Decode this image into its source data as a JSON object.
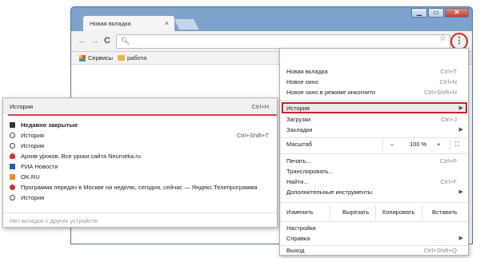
{
  "browser": {
    "tab_title": "Новая вкладка",
    "tab_close": "×",
    "window_buttons": [
      "▁",
      "▭",
      "✕"
    ],
    "nav": [
      "←",
      "→",
      "C"
    ],
    "bookmarks": [
      "Сервисы",
      "работа"
    ]
  },
  "menu": {
    "items": [
      {
        "label": "Новая вкладка",
        "shortcut": "Ctrl+T"
      },
      {
        "label": "Новое окно",
        "shortcut": "Ctrl+N"
      },
      {
        "label": "Новое окно в режиме инкогнито",
        "shortcut": "Ctrl+Shift+N"
      },
      {
        "label": "История"
      },
      {
        "label": "Загрузки",
        "shortcut": "Ctrl+J"
      },
      {
        "label": "Закладки"
      },
      {
        "label": "Печать...",
        "shortcut": "Ctrl+P"
      },
      {
        "label": "Транслировать..."
      },
      {
        "label": "Найти...",
        "shortcut": "Ctrl+F"
      },
      {
        "label": "Дополнительные инструменты"
      },
      {
        "label": "Настройки"
      },
      {
        "label": "Справка"
      },
      {
        "label": "Выход",
        "shortcut": "Ctrl+Shift+Q"
      }
    ],
    "zoom": {
      "label": "Масштаб",
      "minus": "–",
      "value": "100 %",
      "plus": "+",
      "fullscreen": "⛶"
    },
    "edit": {
      "label": "Изменить",
      "cut": "Вырезать",
      "copy": "Копировать",
      "paste": "Вставить"
    }
  },
  "history": {
    "title": "История",
    "shortcut": "Ctrl+H",
    "items": [
      {
        "label": "Недавно закрытые"
      },
      {
        "label": "История",
        "shortcut": "Ctrl+Shift+T"
      },
      {
        "label": "История"
      },
      {
        "label": "Архив уроков. Все уроки сайта Neumeka.ru"
      },
      {
        "label": "РИА Новости"
      },
      {
        "label": "OK.RU"
      },
      {
        "label": "Программа передач в Москве на неделю, сегодня, сейчас — Яндекс.Телепрограмма"
      },
      {
        "label": "История"
      }
    ],
    "footer": "Нет вкладок с других устройств"
  }
}
